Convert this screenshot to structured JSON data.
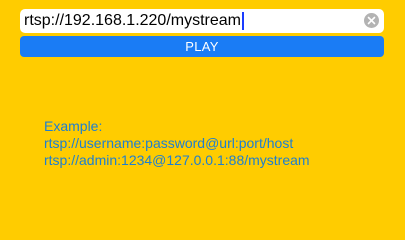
{
  "url_field": {
    "value": "rtsp://192.168.1.220/mystream",
    "clear_icon": "clear-circle-x-icon"
  },
  "play_button": {
    "label": "PLAY"
  },
  "example": {
    "heading": "Example:",
    "line1": "rtsp://username:password@url:port/host",
    "line2": "rtsp://admin:1234@127.0.0.1:88/mystream"
  },
  "colors": {
    "background": "#FFCC00",
    "play_button": "#1A7CF5",
    "example_text": "#1E7FD0"
  }
}
